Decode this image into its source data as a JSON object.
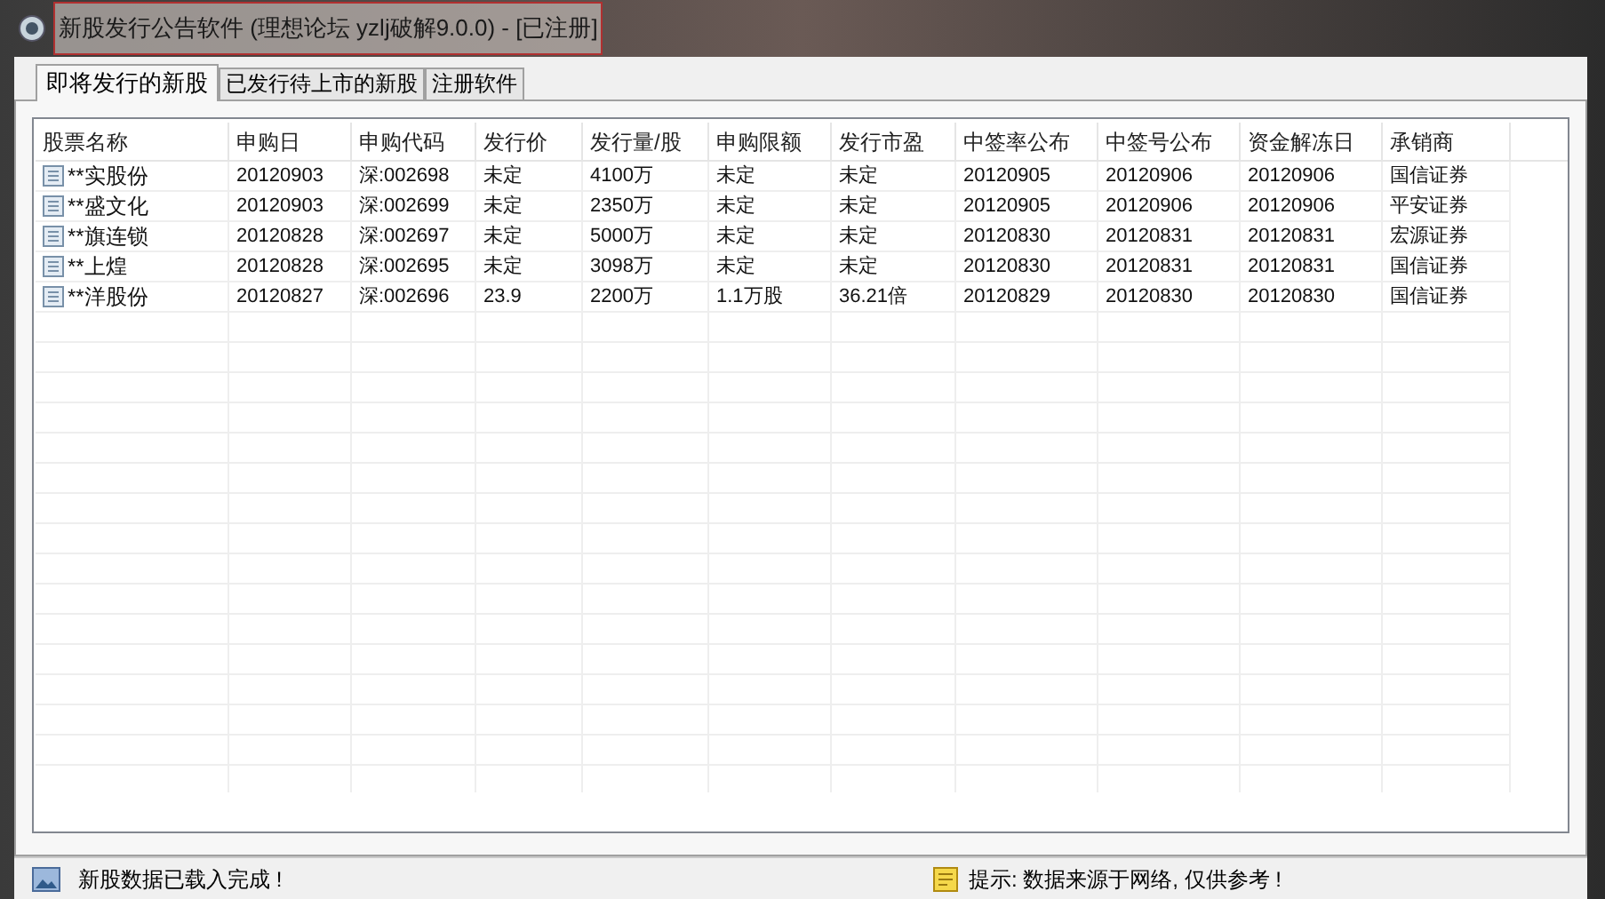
{
  "window": {
    "title": "新股发行公告软件 (理想论坛  yzlj破解9.0.0) - [已注册]"
  },
  "tabs": [
    {
      "label": "即将发行的新股",
      "selected": true
    },
    {
      "label": "已发行待上市的新股",
      "selected": false
    },
    {
      "label": "注册软件",
      "selected": false
    }
  ],
  "table": {
    "columns": [
      "股票名称",
      "申购日",
      "申购代码",
      "发行价",
      "发行量/股",
      "申购限额",
      "发行市盈",
      "中签率公布",
      "中签号公布",
      "资金解冻日",
      "承销商"
    ],
    "rows": [
      {
        "cells": [
          "**实股份",
          "20120903",
          "深:002698",
          "未定",
          "4100万",
          "未定",
          "未定",
          "20120905",
          "20120906",
          "20120906",
          "国信证券"
        ]
      },
      {
        "cells": [
          "**盛文化",
          "20120903",
          "深:002699",
          "未定",
          "2350万",
          "未定",
          "未定",
          "20120905",
          "20120906",
          "20120906",
          "平安证券"
        ]
      },
      {
        "cells": [
          "**旗连锁",
          "20120828",
          "深:002697",
          "未定",
          "5000万",
          "未定",
          "未定",
          "20120830",
          "20120831",
          "20120831",
          "宏源证券"
        ]
      },
      {
        "cells": [
          "**上煌",
          "20120828",
          "深:002695",
          "未定",
          "3098万",
          "未定",
          "未定",
          "20120830",
          "20120831",
          "20120831",
          "国信证券"
        ]
      },
      {
        "cells": [
          "**洋股份",
          "20120827",
          "深:002696",
          "23.9",
          "2200万",
          "1.1万股",
          "36.21倍",
          "20120829",
          "20120830",
          "20120830",
          "国信证券"
        ]
      }
    ]
  },
  "status_bar": {
    "message": "新股数据已载入完成 !",
    "hint": "提示: 数据来源于网络, 仅供参考 !"
  }
}
